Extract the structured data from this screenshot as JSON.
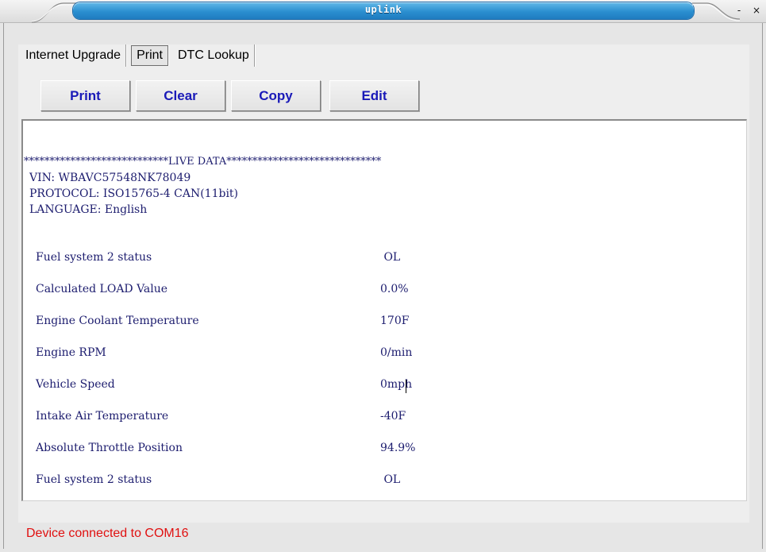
{
  "window": {
    "title": "uplink",
    "controls": {
      "minimize": "-",
      "close": "×"
    }
  },
  "tabs": [
    {
      "label": "Internet Upgrade"
    },
    {
      "label": "Print"
    },
    {
      "label": "DTC Lookup"
    }
  ],
  "active_tab": "Print",
  "toolbar": {
    "print_label": "Print",
    "clear_label": "Clear",
    "copy_label": "Copy",
    "edit_label": "Edit"
  },
  "report": {
    "banner": "****************************LIVE DATA******************************",
    "vin": "VIN: WBAVC57548NK78049",
    "protocol": "PROTOCOL: ISO15765-4 CAN(11bit)",
    "language": "LANGUAGE: English",
    "rows": [
      {
        "name": "Fuel system 2 status",
        "value": " OL"
      },
      {
        "name": "Calculated LOAD Value",
        "value": "0.0%"
      },
      {
        "name": "Engine Coolant Temperature",
        "value": "170F"
      },
      {
        "name": "Engine RPM",
        "value": "0/min"
      },
      {
        "name": "Vehicle Speed",
        "value": "0mph"
      },
      {
        "name": "Intake Air Temperature",
        "value": "-40F"
      },
      {
        "name": "Absolute Throttle Position",
        "value": "94.9%"
      },
      {
        "name": "Fuel system 2 status",
        "value": " OL"
      }
    ]
  },
  "status_bar": {
    "text": "Device connected to COM16",
    "color": "#e01010"
  },
  "colors": {
    "title_accent": "#2b8fd0",
    "button_text": "#1a1ab8",
    "report_text": "#1c1c6e"
  }
}
